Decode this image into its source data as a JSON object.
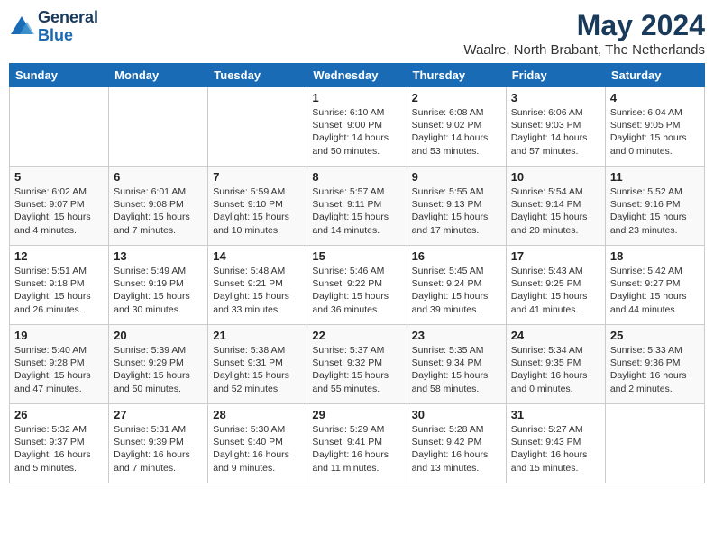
{
  "logo": {
    "general": "General",
    "blue": "Blue"
  },
  "header": {
    "month_year": "May 2024",
    "location": "Waalre, North Brabant, The Netherlands"
  },
  "weekdays": [
    "Sunday",
    "Monday",
    "Tuesday",
    "Wednesday",
    "Thursday",
    "Friday",
    "Saturday"
  ],
  "weeks": [
    {
      "days": [
        {
          "num": "",
          "info": ""
        },
        {
          "num": "",
          "info": ""
        },
        {
          "num": "",
          "info": ""
        },
        {
          "num": "1",
          "info": "Sunrise: 6:10 AM\nSunset: 9:00 PM\nDaylight: 14 hours\nand 50 minutes."
        },
        {
          "num": "2",
          "info": "Sunrise: 6:08 AM\nSunset: 9:02 PM\nDaylight: 14 hours\nand 53 minutes."
        },
        {
          "num": "3",
          "info": "Sunrise: 6:06 AM\nSunset: 9:03 PM\nDaylight: 14 hours\nand 57 minutes."
        },
        {
          "num": "4",
          "info": "Sunrise: 6:04 AM\nSunset: 9:05 PM\nDaylight: 15 hours\nand 0 minutes."
        }
      ]
    },
    {
      "days": [
        {
          "num": "5",
          "info": "Sunrise: 6:02 AM\nSunset: 9:07 PM\nDaylight: 15 hours\nand 4 minutes."
        },
        {
          "num": "6",
          "info": "Sunrise: 6:01 AM\nSunset: 9:08 PM\nDaylight: 15 hours\nand 7 minutes."
        },
        {
          "num": "7",
          "info": "Sunrise: 5:59 AM\nSunset: 9:10 PM\nDaylight: 15 hours\nand 10 minutes."
        },
        {
          "num": "8",
          "info": "Sunrise: 5:57 AM\nSunset: 9:11 PM\nDaylight: 15 hours\nand 14 minutes."
        },
        {
          "num": "9",
          "info": "Sunrise: 5:55 AM\nSunset: 9:13 PM\nDaylight: 15 hours\nand 17 minutes."
        },
        {
          "num": "10",
          "info": "Sunrise: 5:54 AM\nSunset: 9:14 PM\nDaylight: 15 hours\nand 20 minutes."
        },
        {
          "num": "11",
          "info": "Sunrise: 5:52 AM\nSunset: 9:16 PM\nDaylight: 15 hours\nand 23 minutes."
        }
      ]
    },
    {
      "days": [
        {
          "num": "12",
          "info": "Sunrise: 5:51 AM\nSunset: 9:18 PM\nDaylight: 15 hours\nand 26 minutes."
        },
        {
          "num": "13",
          "info": "Sunrise: 5:49 AM\nSunset: 9:19 PM\nDaylight: 15 hours\nand 30 minutes."
        },
        {
          "num": "14",
          "info": "Sunrise: 5:48 AM\nSunset: 9:21 PM\nDaylight: 15 hours\nand 33 minutes."
        },
        {
          "num": "15",
          "info": "Sunrise: 5:46 AM\nSunset: 9:22 PM\nDaylight: 15 hours\nand 36 minutes."
        },
        {
          "num": "16",
          "info": "Sunrise: 5:45 AM\nSunset: 9:24 PM\nDaylight: 15 hours\nand 39 minutes."
        },
        {
          "num": "17",
          "info": "Sunrise: 5:43 AM\nSunset: 9:25 PM\nDaylight: 15 hours\nand 41 minutes."
        },
        {
          "num": "18",
          "info": "Sunrise: 5:42 AM\nSunset: 9:27 PM\nDaylight: 15 hours\nand 44 minutes."
        }
      ]
    },
    {
      "days": [
        {
          "num": "19",
          "info": "Sunrise: 5:40 AM\nSunset: 9:28 PM\nDaylight: 15 hours\nand 47 minutes."
        },
        {
          "num": "20",
          "info": "Sunrise: 5:39 AM\nSunset: 9:29 PM\nDaylight: 15 hours\nand 50 minutes."
        },
        {
          "num": "21",
          "info": "Sunrise: 5:38 AM\nSunset: 9:31 PM\nDaylight: 15 hours\nand 52 minutes."
        },
        {
          "num": "22",
          "info": "Sunrise: 5:37 AM\nSunset: 9:32 PM\nDaylight: 15 hours\nand 55 minutes."
        },
        {
          "num": "23",
          "info": "Sunrise: 5:35 AM\nSunset: 9:34 PM\nDaylight: 15 hours\nand 58 minutes."
        },
        {
          "num": "24",
          "info": "Sunrise: 5:34 AM\nSunset: 9:35 PM\nDaylight: 16 hours\nand 0 minutes."
        },
        {
          "num": "25",
          "info": "Sunrise: 5:33 AM\nSunset: 9:36 PM\nDaylight: 16 hours\nand 2 minutes."
        }
      ]
    },
    {
      "days": [
        {
          "num": "26",
          "info": "Sunrise: 5:32 AM\nSunset: 9:37 PM\nDaylight: 16 hours\nand 5 minutes."
        },
        {
          "num": "27",
          "info": "Sunrise: 5:31 AM\nSunset: 9:39 PM\nDaylight: 16 hours\nand 7 minutes."
        },
        {
          "num": "28",
          "info": "Sunrise: 5:30 AM\nSunset: 9:40 PM\nDaylight: 16 hours\nand 9 minutes."
        },
        {
          "num": "29",
          "info": "Sunrise: 5:29 AM\nSunset: 9:41 PM\nDaylight: 16 hours\nand 11 minutes."
        },
        {
          "num": "30",
          "info": "Sunrise: 5:28 AM\nSunset: 9:42 PM\nDaylight: 16 hours\nand 13 minutes."
        },
        {
          "num": "31",
          "info": "Sunrise: 5:27 AM\nSunset: 9:43 PM\nDaylight: 16 hours\nand 15 minutes."
        },
        {
          "num": "",
          "info": ""
        }
      ]
    }
  ]
}
